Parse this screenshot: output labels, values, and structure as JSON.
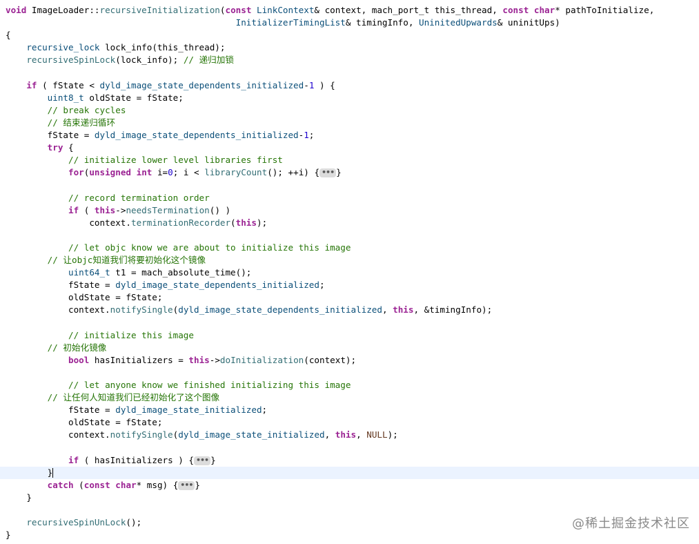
{
  "colors": {
    "background": "#ffffff",
    "keyword": "#9b2393",
    "function": "#326d74",
    "type": "#0b4f79",
    "macro": "#643820",
    "comment": "#267507",
    "number": "#1c00cf",
    "current_line_highlight": "#ebf3ff"
  },
  "code": {
    "current_line": 37,
    "lines": [
      [
        [
          "t-keyword",
          "void"
        ],
        [
          "t-plain",
          " ImageLoader::"
        ],
        [
          "t-func",
          "recursiveInitialization"
        ],
        [
          "t-plain",
          "("
        ],
        [
          "t-keyword",
          "const"
        ],
        [
          "t-plain",
          " "
        ],
        [
          "t-type",
          "LinkContext"
        ],
        [
          "t-plain",
          "& context, mach_port_t this_thread, "
        ],
        [
          "t-keyword",
          "const"
        ],
        [
          "t-plain",
          " "
        ],
        [
          "t-keyword",
          "char"
        ],
        [
          "t-plain",
          "* pathToInitialize,"
        ]
      ],
      [
        [
          "t-plain",
          "                                            "
        ],
        [
          "t-type",
          "InitializerTimingList"
        ],
        [
          "t-plain",
          "& timingInfo, "
        ],
        [
          "t-type",
          "UninitedUpwards"
        ],
        [
          "t-plain",
          "& uninitUps)"
        ]
      ],
      [
        [
          "t-plain",
          "{"
        ]
      ],
      [
        [
          "t-plain",
          "    "
        ],
        [
          "t-type",
          "recursive_lock"
        ],
        [
          "t-plain",
          " lock_info(this_thread);"
        ]
      ],
      [
        [
          "t-plain",
          "    "
        ],
        [
          "t-func",
          "recursiveSpinLock"
        ],
        [
          "t-plain",
          "(lock_info); "
        ],
        [
          "t-comment",
          "// 递归加锁"
        ]
      ],
      [],
      [
        [
          "t-plain",
          "    "
        ],
        [
          "t-keyword",
          "if"
        ],
        [
          "t-plain",
          " ( fState < "
        ],
        [
          "t-type",
          "dyld_image_state_dependents_initialized"
        ],
        [
          "t-plain",
          "-"
        ],
        [
          "t-number",
          "1"
        ],
        [
          "t-plain",
          " ) {"
        ]
      ],
      [
        [
          "t-plain",
          "        "
        ],
        [
          "t-type",
          "uint8_t"
        ],
        [
          "t-plain",
          " oldState = fState;"
        ]
      ],
      [
        [
          "t-plain",
          "        "
        ],
        [
          "t-comment",
          "// break cycles"
        ]
      ],
      [
        [
          "t-plain",
          "        "
        ],
        [
          "t-comment",
          "// 结束递归循环"
        ]
      ],
      [
        [
          "t-plain",
          "        fState = "
        ],
        [
          "t-type",
          "dyld_image_state_dependents_initialized"
        ],
        [
          "t-plain",
          "-"
        ],
        [
          "t-number",
          "1"
        ],
        [
          "t-plain",
          ";"
        ]
      ],
      [
        [
          "t-plain",
          "        "
        ],
        [
          "t-keyword",
          "try"
        ],
        [
          "t-plain",
          " {"
        ]
      ],
      [
        [
          "t-plain",
          "            "
        ],
        [
          "t-comment",
          "// initialize lower level libraries first"
        ]
      ],
      [
        [
          "t-plain",
          "            "
        ],
        [
          "t-keyword",
          "for"
        ],
        [
          "t-plain",
          "("
        ],
        [
          "t-keyword",
          "unsigned"
        ],
        [
          "t-plain",
          " "
        ],
        [
          "t-keyword",
          "int"
        ],
        [
          "t-plain",
          " i="
        ],
        [
          "t-number",
          "0"
        ],
        [
          "t-plain",
          "; i < "
        ],
        [
          "t-func",
          "libraryCount"
        ],
        [
          "t-plain",
          "(); ++i) {"
        ],
        [
          "t-fold",
          "•••"
        ],
        [
          "t-plain",
          "}"
        ]
      ],
      [],
      [
        [
          "t-plain",
          "            "
        ],
        [
          "t-comment",
          "// record termination order"
        ]
      ],
      [
        [
          "t-plain",
          "            "
        ],
        [
          "t-keyword",
          "if"
        ],
        [
          "t-plain",
          " ( "
        ],
        [
          "t-keyword",
          "this"
        ],
        [
          "t-plain",
          "->"
        ],
        [
          "t-func",
          "needsTermination"
        ],
        [
          "t-plain",
          "() )"
        ]
      ],
      [
        [
          "t-plain",
          "                context."
        ],
        [
          "t-func",
          "terminationRecorder"
        ],
        [
          "t-plain",
          "("
        ],
        [
          "t-keyword",
          "this"
        ],
        [
          "t-plain",
          ");"
        ]
      ],
      [],
      [
        [
          "t-plain",
          "            "
        ],
        [
          "t-comment",
          "// let objc know we are about to initialize this image"
        ]
      ],
      [
        [
          "t-plain",
          "        "
        ],
        [
          "t-comment",
          "// 让objc知道我们将要初始化这个镜像"
        ]
      ],
      [
        [
          "t-plain",
          "            "
        ],
        [
          "t-type",
          "uint64_t"
        ],
        [
          "t-plain",
          " t1 = mach_absolute_time();"
        ]
      ],
      [
        [
          "t-plain",
          "            fState = "
        ],
        [
          "t-type",
          "dyld_image_state_dependents_initialized"
        ],
        [
          "t-plain",
          ";"
        ]
      ],
      [
        [
          "t-plain",
          "            oldState = fState;"
        ]
      ],
      [
        [
          "t-plain",
          "            context."
        ],
        [
          "t-func",
          "notifySingle"
        ],
        [
          "t-plain",
          "("
        ],
        [
          "t-type",
          "dyld_image_state_dependents_initialized"
        ],
        [
          "t-plain",
          ", "
        ],
        [
          "t-keyword",
          "this"
        ],
        [
          "t-plain",
          ", &timingInfo);"
        ]
      ],
      [],
      [
        [
          "t-plain",
          "            "
        ],
        [
          "t-comment",
          "// initialize this image"
        ]
      ],
      [
        [
          "t-plain",
          "        "
        ],
        [
          "t-comment",
          "// 初始化镜像"
        ]
      ],
      [
        [
          "t-plain",
          "            "
        ],
        [
          "t-keyword",
          "bool"
        ],
        [
          "t-plain",
          " hasInitializers = "
        ],
        [
          "t-keyword",
          "this"
        ],
        [
          "t-plain",
          "->"
        ],
        [
          "t-func",
          "doInitialization"
        ],
        [
          "t-plain",
          "(context);"
        ]
      ],
      [],
      [
        [
          "t-plain",
          "            "
        ],
        [
          "t-comment",
          "// let anyone know we finished initializing this image"
        ]
      ],
      [
        [
          "t-plain",
          "        "
        ],
        [
          "t-comment",
          "// 让任何人知道我们已经初始化了这个图像"
        ]
      ],
      [
        [
          "t-plain",
          "            fState = "
        ],
        [
          "t-type",
          "dyld_image_state_initialized"
        ],
        [
          "t-plain",
          ";"
        ]
      ],
      [
        [
          "t-plain",
          "            oldState = fState;"
        ]
      ],
      [
        [
          "t-plain",
          "            context."
        ],
        [
          "t-func",
          "notifySingle"
        ],
        [
          "t-plain",
          "("
        ],
        [
          "t-type",
          "dyld_image_state_initialized"
        ],
        [
          "t-plain",
          ", "
        ],
        [
          "t-keyword",
          "this"
        ],
        [
          "t-plain",
          ", "
        ],
        [
          "t-macro",
          "NULL"
        ],
        [
          "t-plain",
          ");"
        ]
      ],
      [],
      [
        [
          "t-plain",
          "            "
        ],
        [
          "t-keyword",
          "if"
        ],
        [
          "t-plain",
          " ( hasInitializers ) {"
        ],
        [
          "t-fold",
          "•••"
        ],
        [
          "t-plain",
          "}"
        ]
      ],
      [
        [
          "t-plain",
          "        }"
        ],
        [
          "t-cursor",
          ""
        ]
      ],
      [
        [
          "t-plain",
          "        "
        ],
        [
          "t-keyword",
          "catch"
        ],
        [
          "t-plain",
          " ("
        ],
        [
          "t-keyword",
          "const"
        ],
        [
          "t-plain",
          " "
        ],
        [
          "t-keyword",
          "char"
        ],
        [
          "t-plain",
          "* msg) {"
        ],
        [
          "t-fold",
          "•••"
        ],
        [
          "t-plain",
          "}"
        ]
      ],
      [
        [
          "t-plain",
          "    }"
        ]
      ],
      [],
      [
        [
          "t-plain",
          "    "
        ],
        [
          "t-func",
          "recursiveSpinUnLock"
        ],
        [
          "t-plain",
          "();"
        ]
      ],
      [
        [
          "t-plain",
          "}"
        ]
      ]
    ]
  },
  "watermark": "@稀土掘金技术社区"
}
